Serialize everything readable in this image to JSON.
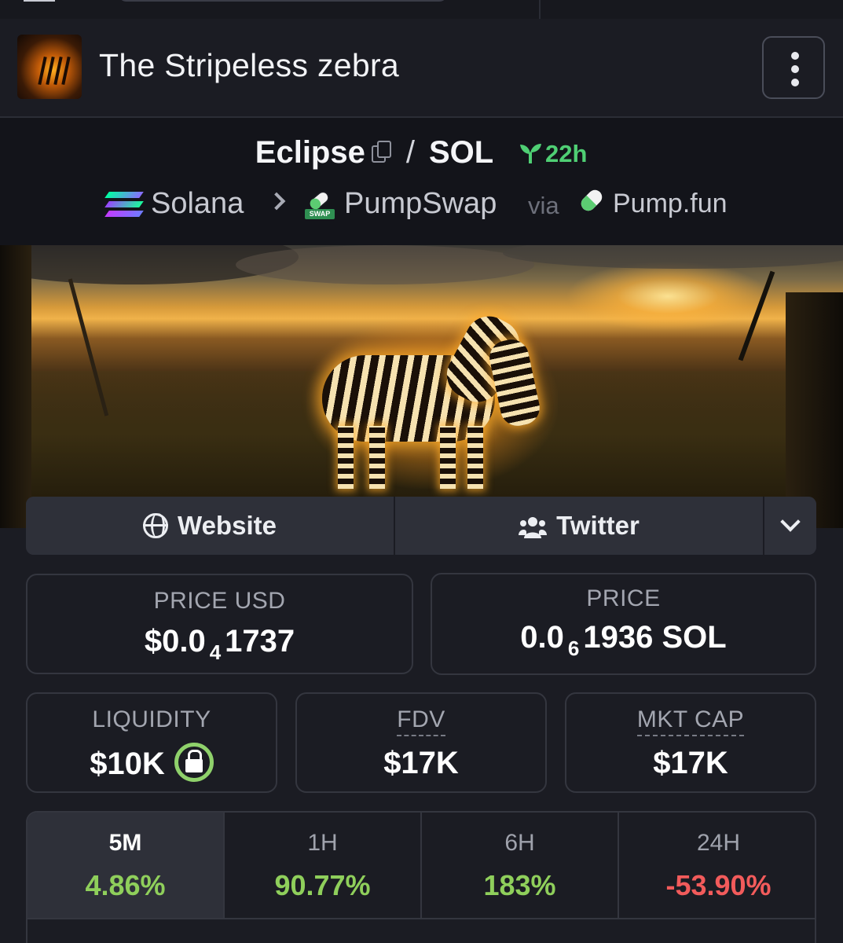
{
  "header": {
    "title": "The Stripeless zebra"
  },
  "pair": {
    "base": "Eclipse",
    "separator": "/",
    "quote": "SOL",
    "age": "22h",
    "chain": "Solana",
    "dex": "PumpSwap",
    "via_label": "via",
    "launchpad": "Pump.fun",
    "dex_badge": "SWAP"
  },
  "links": {
    "website": "Website",
    "twitter": "Twitter"
  },
  "stats": {
    "price_usd": {
      "label": "PRICE USD",
      "prefix": "$0.0",
      "zeros": "4",
      "digits": "1737"
    },
    "price": {
      "label": "PRICE",
      "prefix": "0.0",
      "zeros": "6",
      "digits": "1936 SOL"
    },
    "liquidity": {
      "label": "LIQUIDITY",
      "value": "$10K"
    },
    "fdv": {
      "label": "FDV",
      "value": "$17K"
    },
    "mkt_cap": {
      "label": "MKT CAP",
      "value": "$17K"
    }
  },
  "timeframes": [
    {
      "label": "5M",
      "value": "4.86%",
      "trend": "up",
      "active": true
    },
    {
      "label": "1H",
      "value": "90.77%",
      "trend": "up",
      "active": false
    },
    {
      "label": "6H",
      "value": "183%",
      "trend": "up",
      "active": false
    },
    {
      "label": "24H",
      "value": "-53.90%",
      "trend": "down",
      "active": false
    }
  ],
  "colors": {
    "positive": "#8fcf5b",
    "negative": "#f25b5b",
    "age_green": "#4fcf74",
    "background": "#1b1c23"
  },
  "icons": [
    "copy-icon",
    "sprout-icon",
    "solana-logo-icon",
    "chevron-right-icon",
    "pumpswap-logo-icon",
    "pumpfun-pill-icon",
    "globe-icon",
    "users-icon",
    "chevron-down-icon",
    "lock-icon",
    "kebab-menu-icon"
  ]
}
